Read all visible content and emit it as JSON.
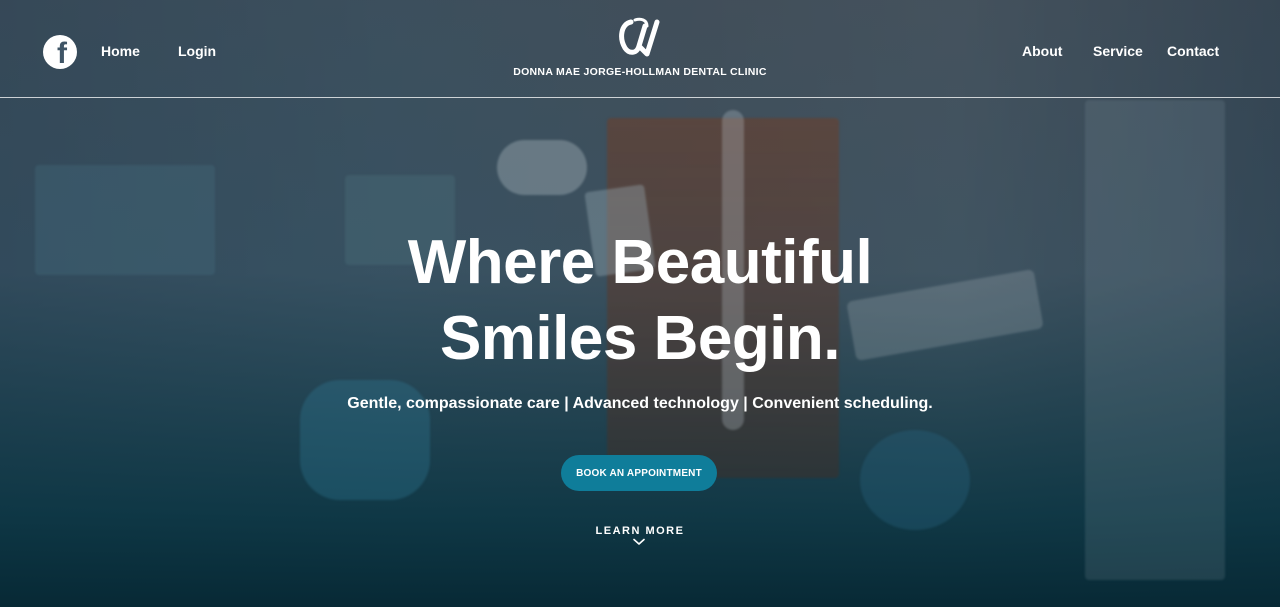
{
  "header": {
    "facebook_icon": "facebook-icon",
    "nav_left": [
      {
        "label": "Home"
      },
      {
        "label": "Login"
      }
    ],
    "nav_right": [
      {
        "label": "About"
      },
      {
        "label": "Service"
      },
      {
        "label": "Contact"
      }
    ],
    "logo_icon": "clinic-monogram-logo",
    "clinic_name": "DONNA MAE JORGE-HOLLMAN DENTAL CLINIC"
  },
  "hero": {
    "title_line1": "Where Beautiful",
    "title_line2": "Smiles Begin.",
    "subtitle": "Gentle, compassionate care | Advanced technology | Convenient scheduling.",
    "cta_label": "BOOK AN APPOINTMENT",
    "learn_more": "LEARN MORE",
    "learn_more_icon": "chevron-down-icon"
  },
  "colors": {
    "cta_background": "#0f7d9a",
    "text": "#ffffff",
    "overlay_dark": "#06283a"
  }
}
